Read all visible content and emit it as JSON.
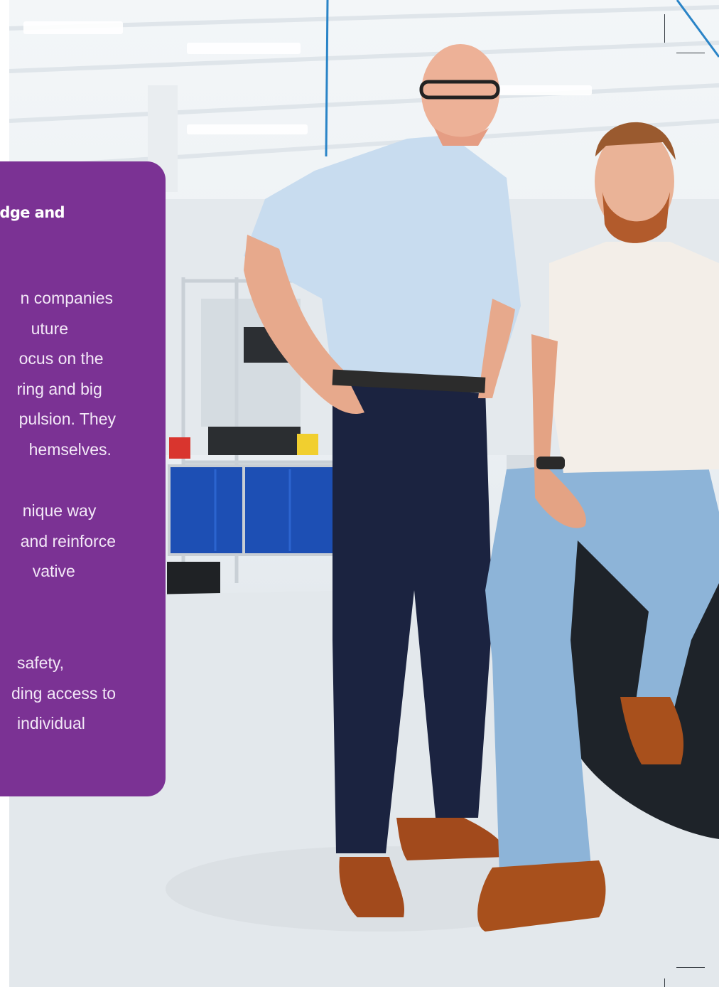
{
  "card": {
    "heading": "dge and",
    "paragraph1": [
      "n companies",
      "uture",
      "ocus on the",
      "ring and big",
      "pulsion. They",
      "hemselves."
    ],
    "paragraph2": [
      "nique way",
      "and reinforce",
      "vative"
    ],
    "paragraph3": [
      "safety,",
      "ding access to",
      "individual"
    ]
  },
  "colors": {
    "card_background": "#7b3294",
    "card_text": "#f3e8f7",
    "floor": "#e3e8ec"
  }
}
